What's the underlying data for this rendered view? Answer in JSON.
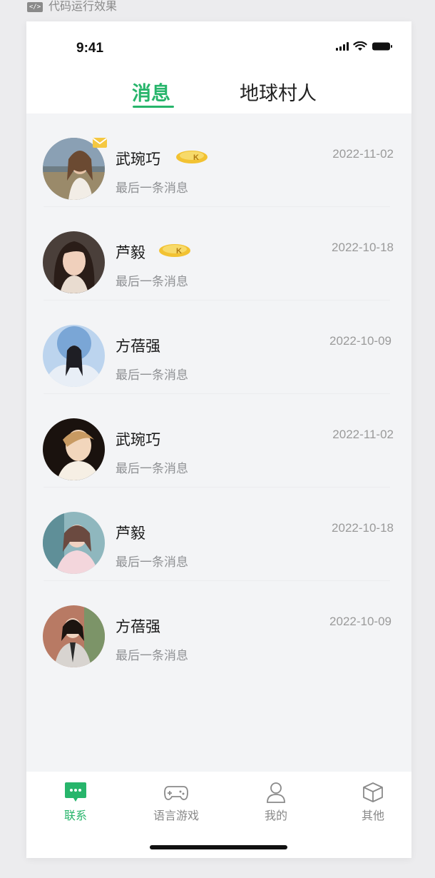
{
  "top_label": {
    "text": "代码运行效果"
  },
  "status_bar": {
    "time": "9:41"
  },
  "header": {
    "tabs": [
      {
        "label": "消息",
        "active": true
      },
      {
        "label": "地球村人",
        "active": false
      }
    ]
  },
  "conversations": [
    {
      "name": "武琬巧",
      "last_message": "最后一条消息",
      "date": "2022-11-02",
      "vip": true,
      "unread_mail": true
    },
    {
      "name": "芦毅",
      "last_message": "最后一条消息",
      "date": "2022-10-18",
      "vip": true,
      "unread_mail": false
    },
    {
      "name": "方蓓强",
      "last_message": "最后一条消息",
      "date": "2022-10-09",
      "vip": false,
      "unread_mail": false
    },
    {
      "name": "武琬巧",
      "last_message": "最后一条消息",
      "date": "2022-11-02",
      "vip": false,
      "unread_mail": false
    },
    {
      "name": "芦毅",
      "last_message": "最后一条消息",
      "date": "2022-10-18",
      "vip": false,
      "unread_mail": false
    },
    {
      "name": "方蓓强",
      "last_message": "最后一条消息",
      "date": "2022-10-09",
      "vip": false,
      "unread_mail": false
    }
  ],
  "tabbar": {
    "items": [
      {
        "label": "联系",
        "icon": "chat-bubble-icon",
        "active": true
      },
      {
        "label": "语言游戏",
        "icon": "gamepad-icon",
        "active": false
      },
      {
        "label": "我的",
        "icon": "person-icon",
        "active": false
      },
      {
        "label": "其他",
        "icon": "cube-icon",
        "active": false
      }
    ]
  },
  "colors": {
    "accent": "#27b56b",
    "vip_gold": "#f2c232",
    "background": "#f3f4f6"
  }
}
